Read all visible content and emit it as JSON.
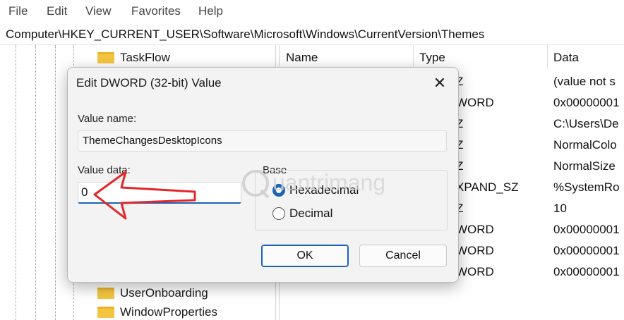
{
  "menu": [
    "File",
    "Edit",
    "View",
    "Favorites",
    "Help"
  ],
  "address_path": "Computer\\HKEY_CURRENT_USER\\Software\\Microsoft\\Windows\\CurrentVersion\\Themes",
  "tree": {
    "nodes": [
      {
        "label": "TaskFlow",
        "icon": "folder-icon"
      },
      {
        "label": "UserOnboarding",
        "icon": "folder-icon"
      },
      {
        "label": "WindowProperties",
        "icon": "folder-icon"
      }
    ]
  },
  "values_list": {
    "columns": [
      "Name",
      "Type",
      "Data"
    ],
    "rows": [
      {
        "type": "Z",
        "data": "(value not s"
      },
      {
        "type": "WORD",
        "data": "0x00000001"
      },
      {
        "type": "Z",
        "data": "C:\\Users\\De"
      },
      {
        "type": "Z",
        "data": "NormalColo"
      },
      {
        "type": "Z",
        "data": "NormalSize"
      },
      {
        "type": "XPAND_SZ",
        "data": "%SystemRo"
      },
      {
        "type": "Z",
        "data": "10"
      },
      {
        "type": "WORD",
        "data": "0x00000001"
      },
      {
        "type": "WORD",
        "data": "0x00000001"
      },
      {
        "type": "WORD",
        "data": "0x00000001"
      }
    ]
  },
  "dialog": {
    "title": "Edit DWORD (32-bit) Value",
    "close_glyph": "✕",
    "value_name_label": "Value name:",
    "value_name": "ThemeChangesDesktopIcons",
    "value_data_label": "Value data:",
    "value_data": "0",
    "base_label": "Base",
    "radios": [
      {
        "label": "Hexadecimal",
        "checked": true
      },
      {
        "label": "Decimal",
        "checked": false
      }
    ],
    "ok_label": "OK",
    "cancel_label": "Cancel"
  },
  "watermark_text": "Quantrimang",
  "colors": {
    "accent": "#1d63b5",
    "folder": "#f4c541",
    "annotation_arrow": "#e3262a",
    "watermark": "#cfcfcf"
  }
}
